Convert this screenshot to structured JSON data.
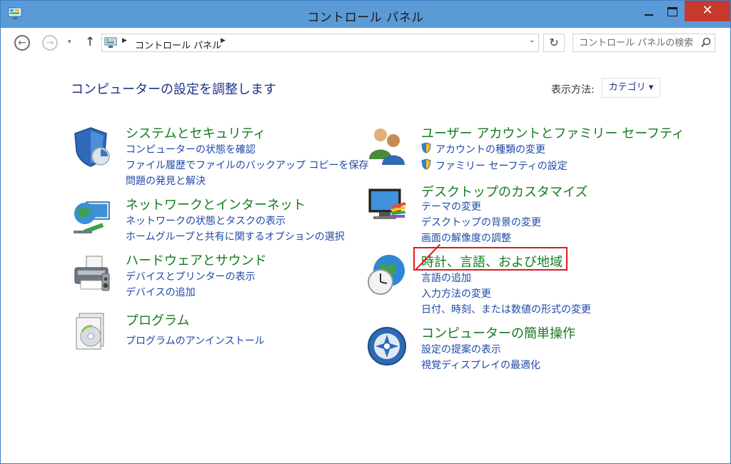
{
  "window": {
    "title": "コントロール パネル"
  },
  "titlebar": {
    "close_glyph": "✕"
  },
  "navbar": {
    "back_glyph": "←",
    "forward_glyph": "→",
    "recent_glyph": "▾",
    "up_glyph": "↑",
    "breadcrumb": "コントロール パネル",
    "sep1": "▶",
    "sep2": "▶",
    "address_dropdown_glyph": "⌄",
    "refresh_glyph": "↻",
    "search_placeholder": "コントロール パネルの検索"
  },
  "main": {
    "heading": "コンピューターの設定を調整します",
    "view_by_label": "表示方法:",
    "view_by_value": "カテゴリ ▾"
  },
  "categories": [
    {
      "title": "システムとセキュリティ",
      "icon": "shield-icon",
      "links": [
        "コンピューターの状態を確認",
        "ファイル履歴でファイルのバックアップ コピーを保存",
        "問題の発見と解決"
      ]
    },
    {
      "title": "ネットワークとインターネット",
      "icon": "network-icon",
      "links": [
        "ネットワークの状態とタスクの表示",
        "ホームグループと共有に関するオプションの選択"
      ]
    },
    {
      "title": "ハードウェアとサウンド",
      "icon": "printer-icon",
      "links": [
        "デバイスとプリンターの表示",
        "デバイスの追加"
      ]
    },
    {
      "title": "プログラム",
      "icon": "programs-icon",
      "links": [
        "プログラムのアンインストール"
      ]
    },
    {
      "title": "ユーザー アカウントとファミリー セーフティ",
      "icon": "users-icon",
      "links": [
        "アカウントの種類の変更",
        "ファミリー セーフティの設定"
      ]
    },
    {
      "title": "デスクトップのカスタマイズ",
      "icon": "desktop-icon",
      "links": [
        "テーマの変更",
        "デスクトップの背景の変更",
        "画面の解像度の調整"
      ]
    },
    {
      "title": "時計、言語、および地域",
      "icon": "clock-globe-icon",
      "links": [
        "言語の追加",
        "入力方法の変更",
        "日付、時刻、または数値の形式の変更"
      ]
    },
    {
      "title": "コンピューターの簡単操作",
      "icon": "ease-of-access-icon",
      "links": [
        "設定の提案の表示",
        "視覚ディスプレイの最適化"
      ]
    }
  ],
  "colors": {
    "titlebar": "#5a9ad6",
    "category_title": "#127b20",
    "link": "#1f49a8",
    "heading": "#1e3287",
    "annotation": "#e01a1a"
  }
}
